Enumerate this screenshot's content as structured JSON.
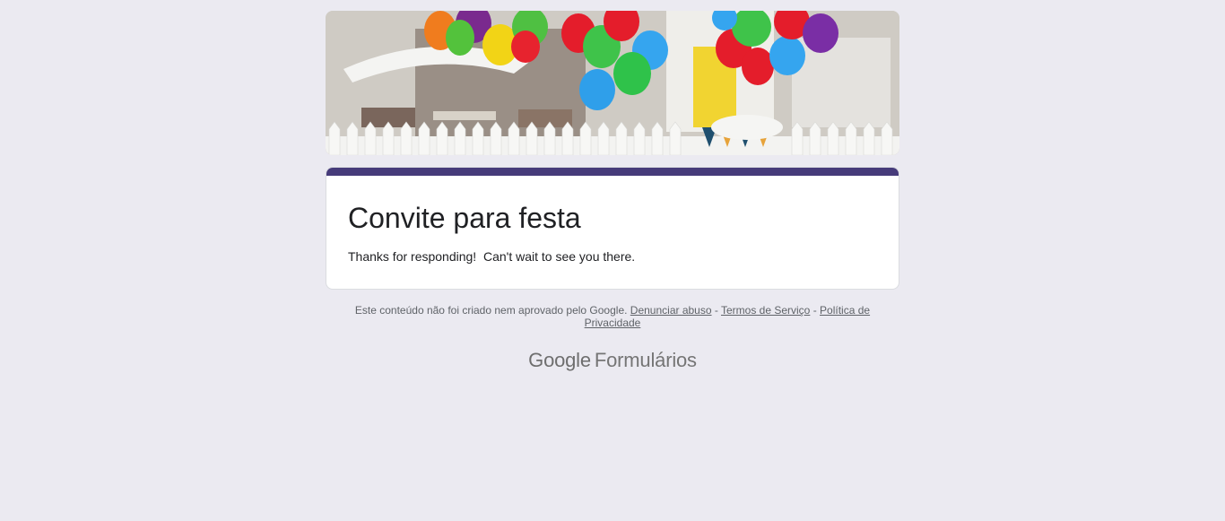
{
  "header": {
    "image_alt": "balloons-and-white-fence-header"
  },
  "form": {
    "title": "Convite para festa",
    "message": "Thanks for responding!  Can't wait to see you there."
  },
  "footer": {
    "disclaimer_text": "Este conteúdo não foi criado nem aprovado pelo Google.",
    "links": [
      {
        "label": "Denunciar abuso"
      },
      {
        "label": "Termos de Serviço"
      },
      {
        "label": "Política de Privacidade"
      }
    ],
    "separator": " - "
  },
  "brand": {
    "google": "Google",
    "product": "Formulários"
  },
  "colors": {
    "background": "#ebeaf1",
    "accent_bar": "#463b7a",
    "card": "#ffffff"
  }
}
